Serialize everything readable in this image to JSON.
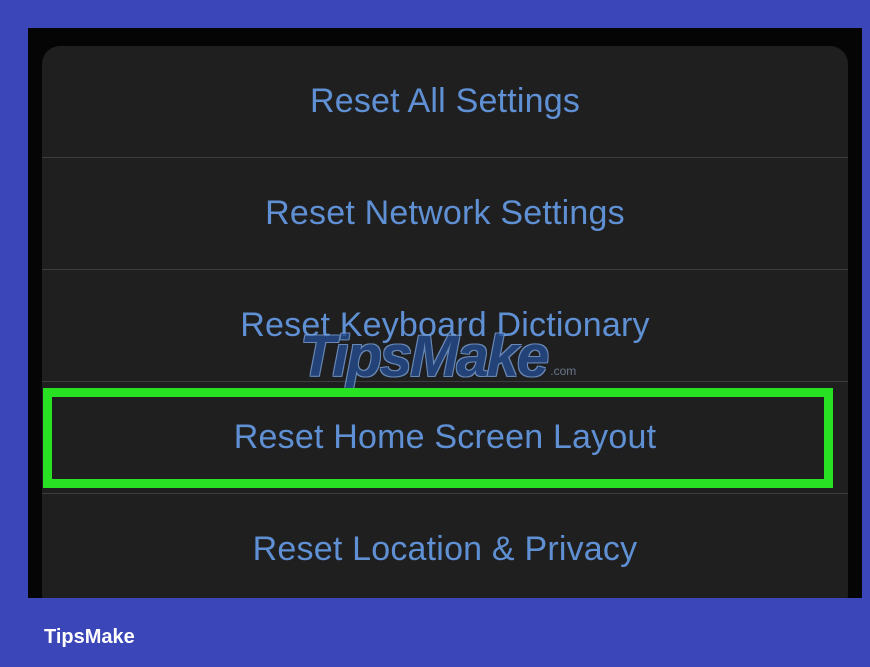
{
  "menu": {
    "items": [
      {
        "label": "Reset All Settings"
      },
      {
        "label": "Reset Network Settings"
      },
      {
        "label": "Reset Keyboard Dictionary"
      },
      {
        "label": "Reset Home Screen Layout"
      },
      {
        "label": "Reset Location & Privacy"
      }
    ]
  },
  "watermark": {
    "text": "TipsMake",
    "domain": ".com"
  },
  "footer": {
    "brand": "TipsMake"
  },
  "colors": {
    "background": "#3b46b8",
    "panel": "#1f1f20",
    "item_text": "#5f90d4",
    "highlight": "#27e122"
  }
}
